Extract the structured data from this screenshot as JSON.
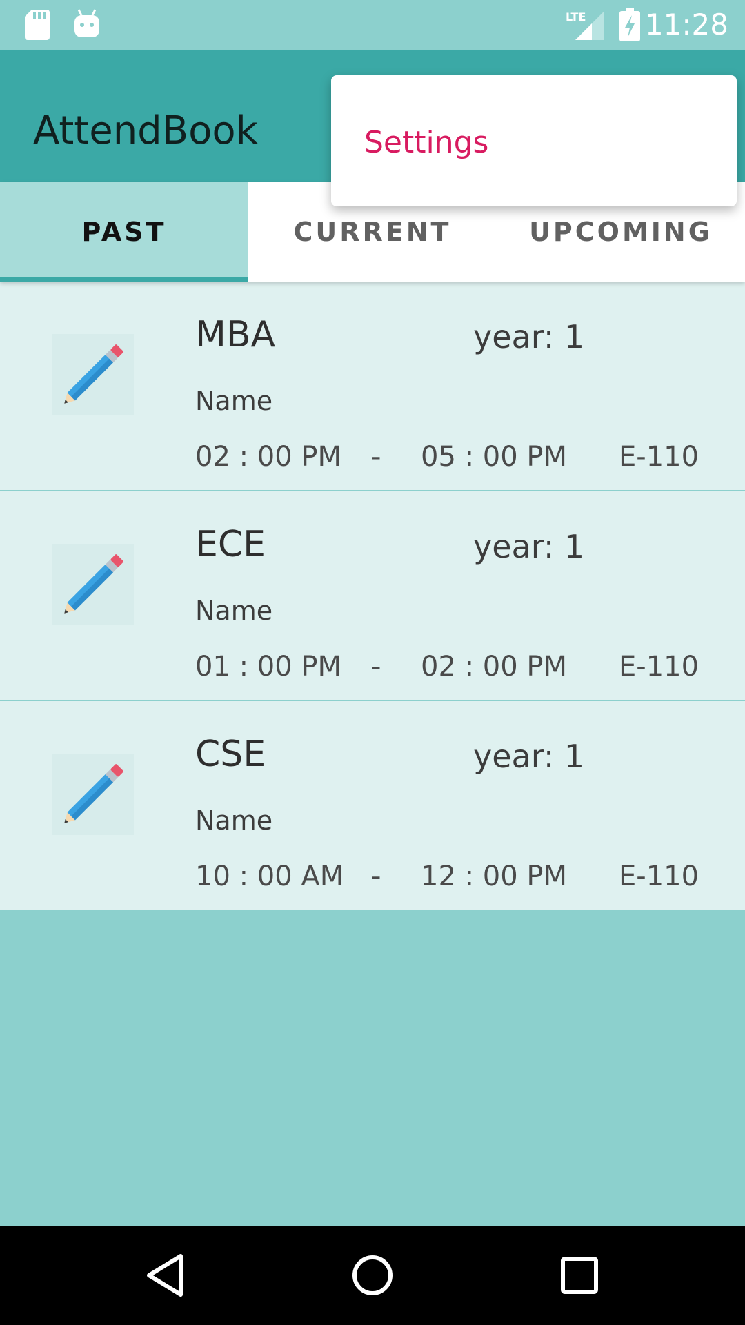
{
  "status_bar": {
    "time": "11:28",
    "network": "LTE",
    "icons": [
      "sd-card-icon",
      "android-icon",
      "lte-signal-icon",
      "battery-charging-icon"
    ]
  },
  "app_bar": {
    "title": "AttendBook"
  },
  "overflow_menu": {
    "items": [
      {
        "label": "Settings"
      }
    ]
  },
  "tabs": [
    {
      "label": "PAST",
      "selected": true
    },
    {
      "label": "CURRENT",
      "selected": false
    },
    {
      "label": "UPCOMING",
      "selected": false
    }
  ],
  "classes": [
    {
      "course": "MBA",
      "year": "year: 1",
      "name": "Name",
      "start": "02 : 00 PM",
      "separator": "-",
      "end": "05 : 00 PM",
      "room": "E-110",
      "icon": "pencil-icon"
    },
    {
      "course": "ECE",
      "year": "year: 1",
      "name": "Name",
      "start": "01 : 00 PM",
      "separator": "-",
      "end": "02 : 00 PM",
      "room": "E-110",
      "icon": "pencil-icon"
    },
    {
      "course": "CSE",
      "year": "year: 1",
      "name": "Name",
      "start": "10 : 00 AM",
      "separator": "-",
      "end": "12 : 00 PM",
      "room": "E-110",
      "icon": "pencil-icon"
    }
  ],
  "nav_bar": {
    "buttons": [
      "back-icon",
      "home-icon",
      "recents-icon"
    ]
  },
  "colors": {
    "primary": "#3ba9a6",
    "background": "#8cd0cd",
    "accent": "#d81b60",
    "row_background": "#dff1f0"
  }
}
